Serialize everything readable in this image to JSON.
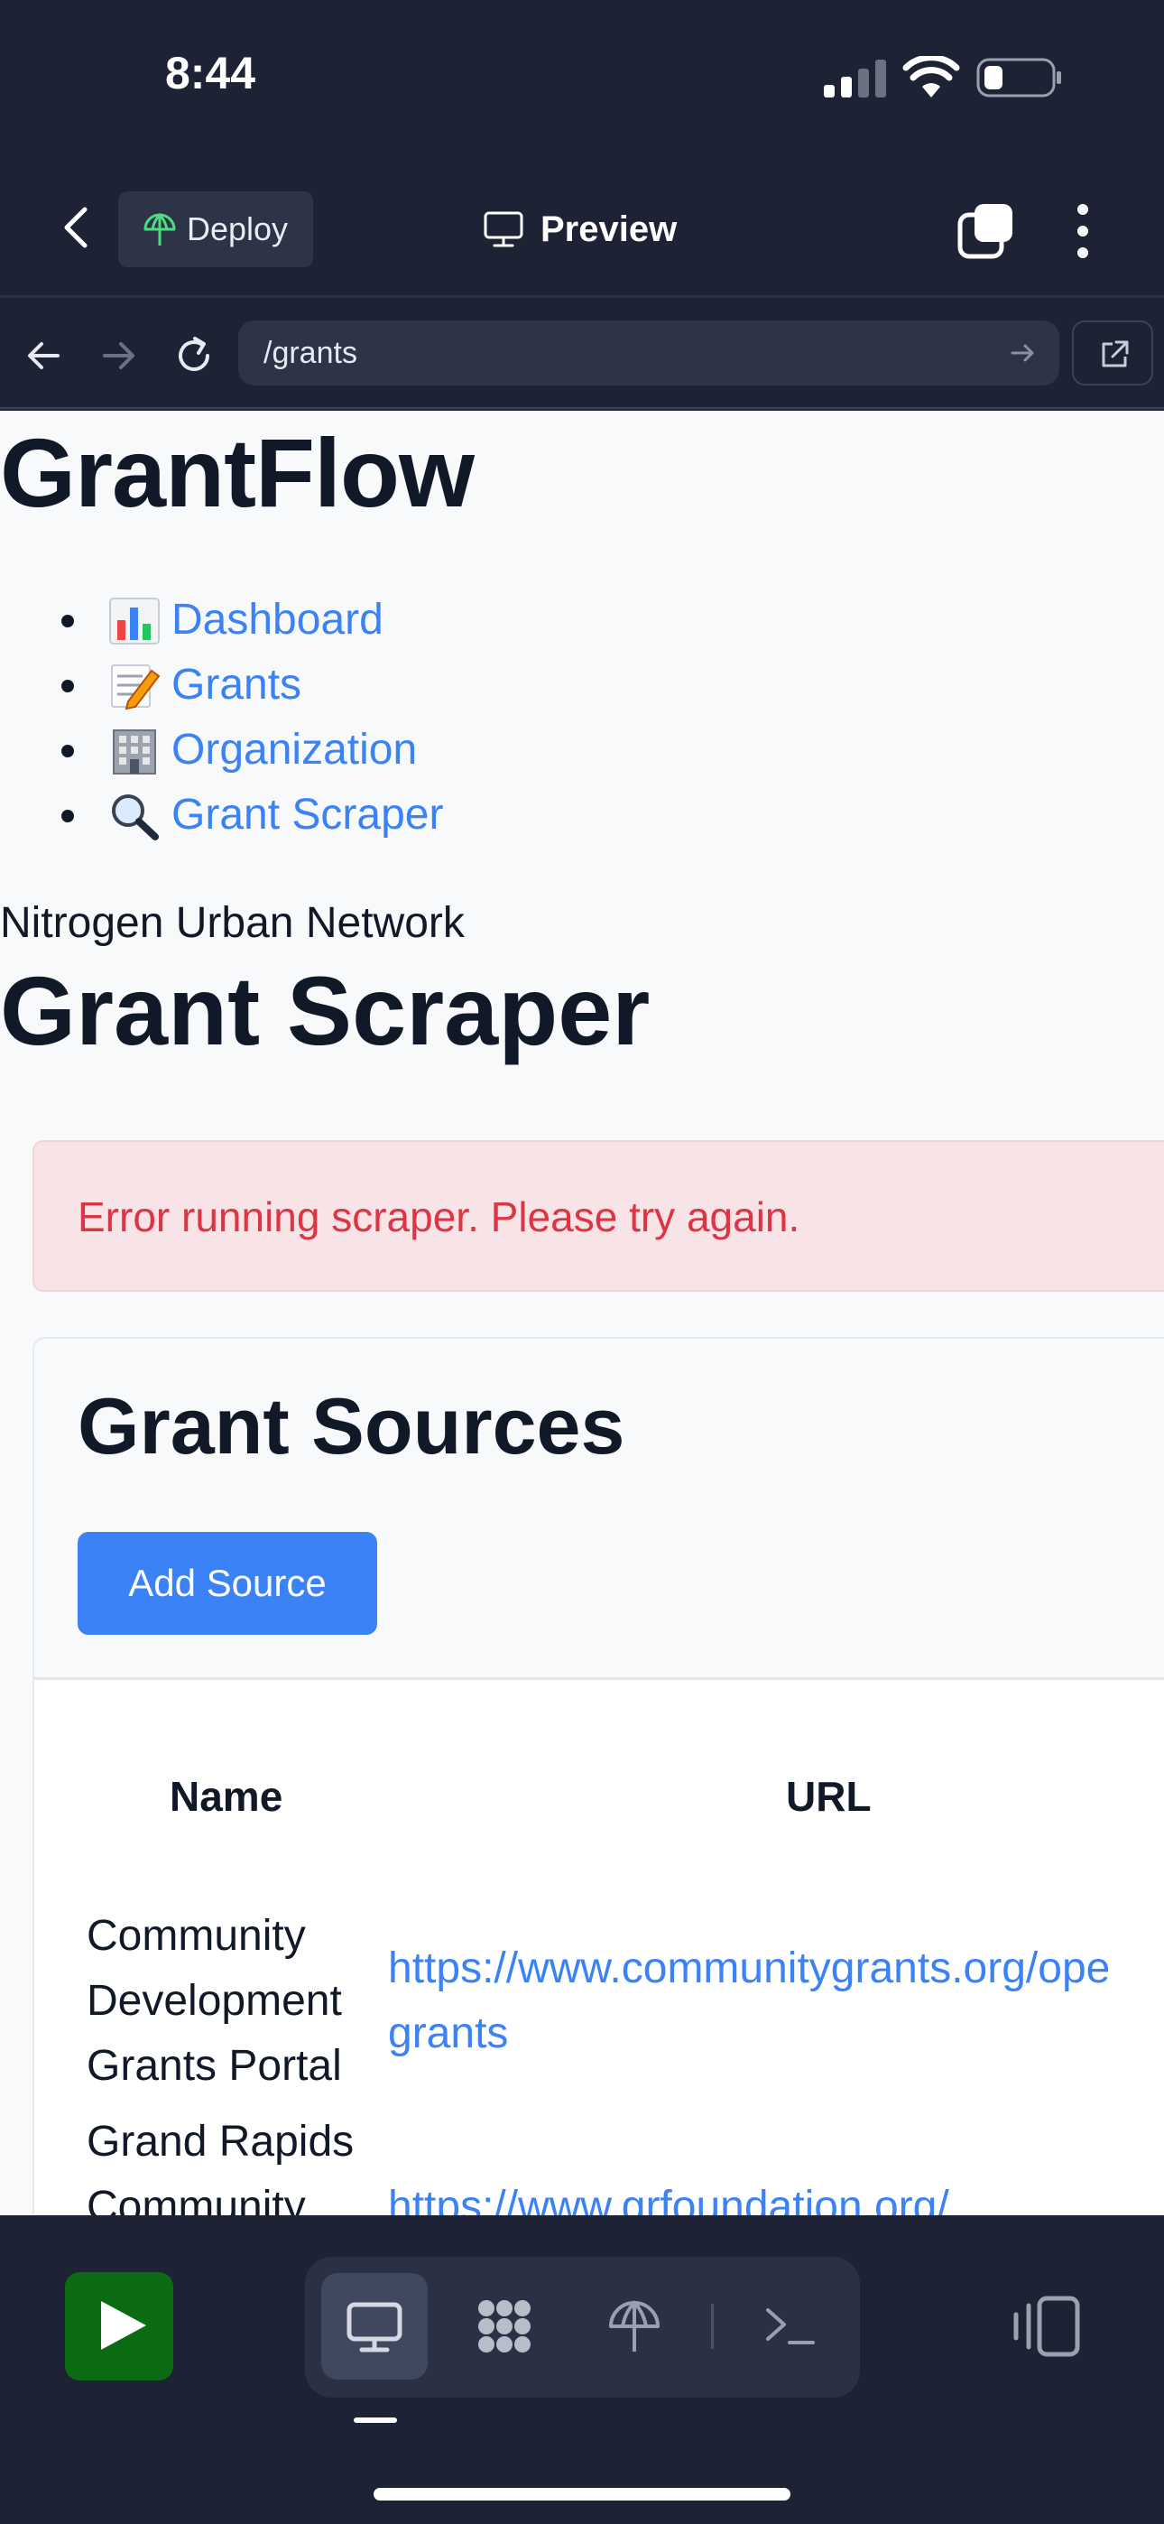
{
  "status_bar": {
    "time": "8:44"
  },
  "header": {
    "deploy_label": "Deploy",
    "preview_label": "Preview"
  },
  "browser": {
    "url": "/grants"
  },
  "site": {
    "title": "GrantFlow",
    "nav": [
      {
        "label": "Dashboard",
        "icon": "bar-chart-emoji"
      },
      {
        "label": "Grants",
        "icon": "memo-emoji"
      },
      {
        "label": "Organization",
        "icon": "office-building-emoji"
      },
      {
        "label": "Grant Scraper",
        "icon": "magnifier-emoji"
      }
    ],
    "org_name": "Nitrogen Urban Network",
    "page_title": "Grant Scraper",
    "error": "Error running scraper. Please try again.",
    "sources_card": {
      "title": "Grant Sources",
      "add_button": "Add Source",
      "columns": [
        "Name",
        "URL"
      ],
      "rows": [
        {
          "name_lines": [
            "Community",
            "Development",
            "Grants Portal"
          ],
          "url_lines": [
            "https://www.communitygrants.org/ope",
            "grants"
          ]
        },
        {
          "name_lines": [
            "Grand Rapids",
            "Community"
          ],
          "url_lines": [
            "https://www.grfoundation.org/"
          ]
        }
      ]
    }
  },
  "colors": {
    "accent": "#3b82f6",
    "error": "#dc3545",
    "run": "#0b6b12",
    "chrome": "#1d2234"
  }
}
